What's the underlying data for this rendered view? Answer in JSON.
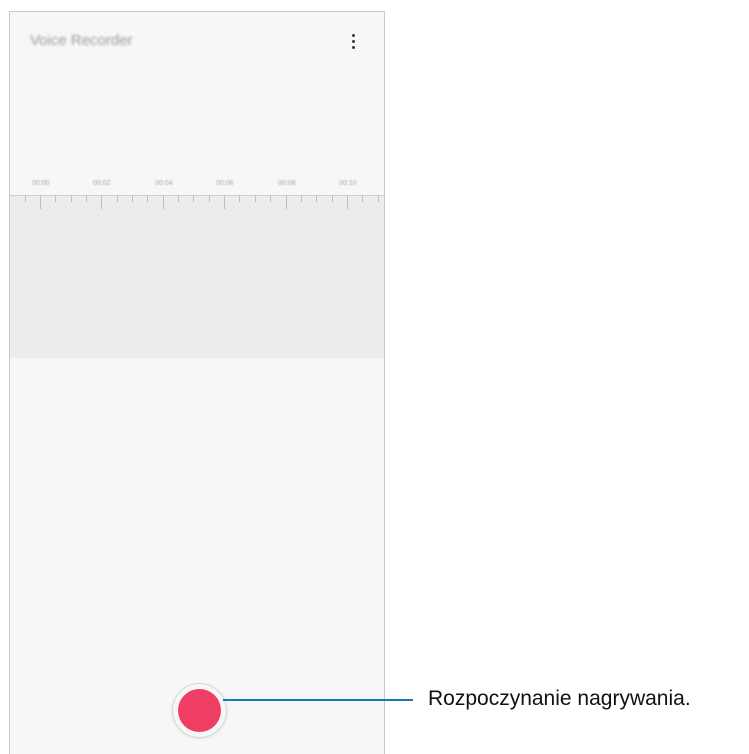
{
  "app": {
    "title": "Voice Recorder"
  },
  "toolbar": {
    "more_icon": "more-vertical-icon"
  },
  "timeline": {
    "labels": [
      "00:00",
      "00:02",
      "00:04",
      "00:06",
      "00:08",
      "00:10"
    ]
  },
  "record": {
    "icon": "record-dot-icon",
    "color": "#ef3e63"
  },
  "callout": {
    "text": "Rozpoczynanie nagrywania.",
    "line_color": "#1679b3"
  }
}
